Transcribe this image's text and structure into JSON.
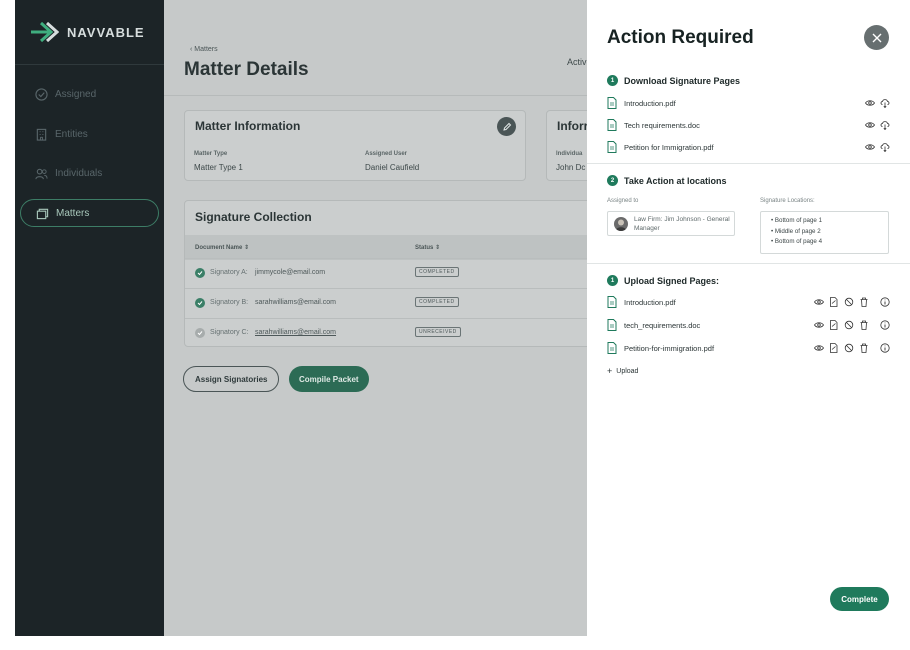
{
  "brand": {
    "name": "NAVVABLE"
  },
  "sidebar": {
    "items": [
      {
        "label": "Assigned",
        "icon": "check-circle-icon"
      },
      {
        "label": "Entities",
        "icon": "building-icon"
      },
      {
        "label": "Individuals",
        "icon": "people-icon"
      },
      {
        "label": "Matters",
        "icon": "folders-icon",
        "active": true
      }
    ]
  },
  "header": {
    "breadcrumb": "‹  Matters",
    "title": "Matter Details",
    "tab_partial": "Activ"
  },
  "matter_info": {
    "title": "Matter Information",
    "type_label": "Matter Type",
    "type_value": "Matter Type 1",
    "user_label": "Assigned User",
    "user_value": "Daniel Caufield"
  },
  "info_card": {
    "title": "Inforr",
    "label": "Individua",
    "value": "John Dc"
  },
  "signature_collection": {
    "title": "Signature Collection",
    "columns": [
      "Document Name ⇕",
      "Status ⇕"
    ],
    "rows": [
      {
        "label": "Signatory A:",
        "email": "jimmycole@email.com",
        "status": "COMPLETED",
        "done": true
      },
      {
        "label": "Signatory B:",
        "email": "sarahwilliams@email.com",
        "status": "COMPLETED",
        "done": true
      },
      {
        "label": "Signatory C:",
        "email": "sarahwilliams@email.com",
        "status": "UNRECEIVED",
        "done": false
      }
    ]
  },
  "buttons": {
    "assign": "Assign Signatories",
    "compile": "Compile Packet"
  },
  "panel": {
    "title": "Action Required",
    "step1": {
      "num": "1",
      "label": "Download Signature Pages",
      "files": [
        "Introduction.pdf",
        "Tech requirements.doc",
        "Petition for Immigration.pdf"
      ]
    },
    "step2": {
      "num": "2",
      "label": "Take Action at locations",
      "assigned_label": "Assigned to",
      "assigned_value": "Law Firm: Jim Johnson - General Manager",
      "locations_label": "Signature Locations:",
      "locations": [
        "Bottom of page 1",
        "Middle of page 2",
        "Bottom of page 4"
      ]
    },
    "step3": {
      "num": "1",
      "label": "Upload Signed Pages:",
      "files": [
        "Introduction.pdf",
        "tech_requirements.doc",
        "Petition-for-immigration.pdf"
      ]
    },
    "upload_label": "Upload",
    "complete_label": "Complete"
  },
  "colors": {
    "accent": "#1f7a5c",
    "sidebar_bg": "#1c2427"
  }
}
